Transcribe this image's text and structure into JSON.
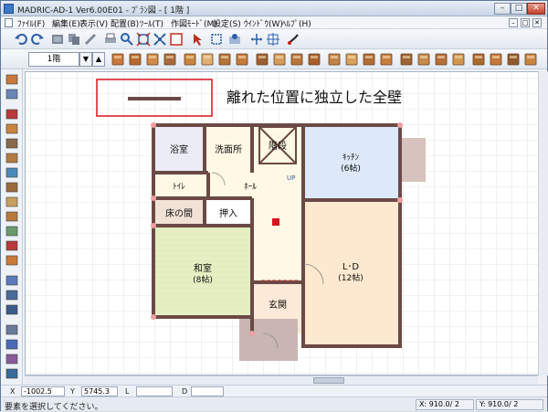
{
  "window": {
    "title": "MADRIC-AD-1 Ver6.00E01 - ﾌﾟﾗﾝ図 - [ 1階 ]",
    "minimize": "–",
    "maximize": "□",
    "close": "✕"
  },
  "menu": {
    "items": [
      "ﾌｧｲﾙ(F)",
      "編集(E)",
      "表示(V)",
      "配置(B)",
      "ﾂｰﾙ(T)",
      "作図ﾓｰﾄﾞ(M)",
      "設定(S)",
      "ｳｲﾝﾄﾞｳ(W)",
      "ﾍﾙﾌﾟ(H)"
    ],
    "mdi_buttons": [
      "–",
      "□",
      "✕"
    ]
  },
  "toolbar": {
    "floor_value": "1階",
    "arrow_down": "▼",
    "arrow_up": "▲"
  },
  "annotation": {
    "text": "離れた位置に独立した全壁"
  },
  "rooms": {
    "bath": "浴室",
    "washroom": "洗面所",
    "stairs": "階段",
    "kitchen": "ｷｯﾁﾝ",
    "kitchen_size": "(6帖)",
    "toilet": "ﾄｲﾚ",
    "hall": "ﾎｰﾙ",
    "tokonoma": "床の間",
    "closet": "押入",
    "washitsu": "和室",
    "washitsu_size": "(8帖)",
    "ld": "L･D",
    "ld_size": "(12帖)",
    "entrance": "玄関",
    "up_label": "UP"
  },
  "coords": {
    "x_label": "X",
    "x_value": "-1002.5",
    "y_label": "Y",
    "y_value": "5745.3",
    "l_label": "L",
    "l_value": "",
    "d_label": "D",
    "d_value": ""
  },
  "status": {
    "message": "要素を選択してください。",
    "x_grid": "X: 910.0/ 2",
    "y_grid": "Y: 910.0/ 2"
  },
  "colors": {
    "accent_red": "#d8141c",
    "wall": "#6b4a46",
    "kitchen_fill": "#dde8f8",
    "washitsu_fill": "#e8f0c8",
    "ld_fill": "#fde9cf",
    "bath_fill": "#ececf6",
    "hall_fill": "#fff8e4"
  }
}
